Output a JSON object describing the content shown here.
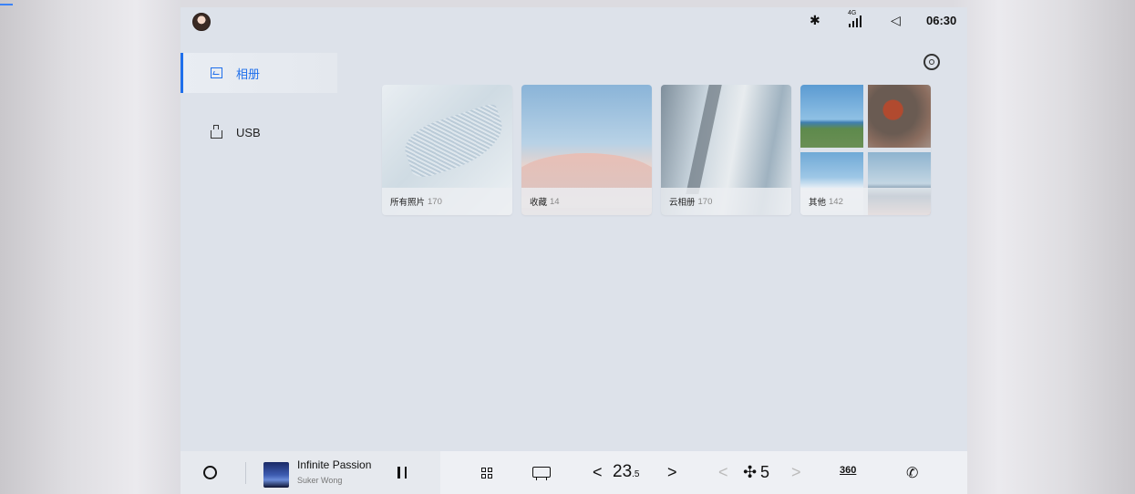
{
  "status_bar": {
    "bluetooth_glyph": "✱",
    "signal_label": "4G",
    "volume_glyph": "◁",
    "time": "06:30"
  },
  "sidebar": {
    "items": [
      {
        "label": "相册",
        "icon": "photo-album-icon",
        "active": true
      },
      {
        "label": "USB",
        "icon": "usb-icon",
        "active": false
      }
    ]
  },
  "albums": [
    {
      "name": "所有照片",
      "count": "170"
    },
    {
      "name": "收藏",
      "count": "14"
    },
    {
      "name": "云相册",
      "count": "170"
    },
    {
      "name": "其他",
      "count": "142"
    }
  ],
  "dock": {
    "song_title": "Infinite Passion",
    "artist": "Suker Wong",
    "temp_left_arrow": "<",
    "temperature": "23",
    "temperature_decimal": ".5",
    "temp_right_arrow": ">",
    "fan_left_arrow": "<",
    "fan_glyph": "✣",
    "fan_level": "5",
    "fan_right_arrow": ">",
    "camera_label": "360",
    "phone_glyph": "✆"
  },
  "colors": {
    "accent": "#1f6feb",
    "screen_bg": "#dde2ea",
    "dock_bg": "#eef0f4"
  }
}
